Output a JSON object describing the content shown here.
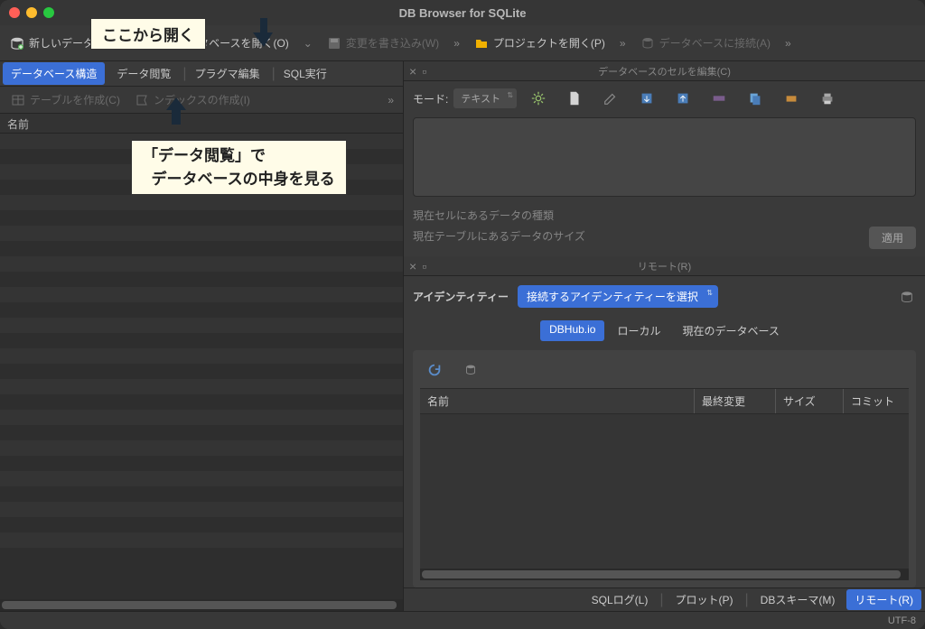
{
  "title": "DB Browser for SQLite",
  "annotation": {
    "callout1": "ここから開く",
    "callout2_line1": "「データ閲覧」で",
    "callout2_line2": "データベースの中身を見る"
  },
  "toolbar": {
    "new_db": "新しいデータベース(N)",
    "open_db": "データベースを開く(O)",
    "write_changes": "変更を書き込み(W)",
    "open_project": "プロジェクトを開く(P)",
    "connect_db": "データベースに接続(A)"
  },
  "tabs": {
    "structure": "データベース構造",
    "browse": "データ閲覧",
    "pragma": "プラグマ編集",
    "sql": "SQL実行"
  },
  "subtools": {
    "create_table": "テーブルを作成(C)",
    "create_index": "ンデックスの作成(I)"
  },
  "list_header": {
    "name": "名前"
  },
  "cell_edit": {
    "title": "データベースのセルを編集(C)",
    "mode_label": "モード:",
    "mode_value": "テキスト",
    "info1": "現在セルにあるデータの種類",
    "info2": "現在テーブルにあるデータのサイズ",
    "apply": "適用"
  },
  "remote": {
    "title": "リモート(R)",
    "identity_label": "アイデンティティー",
    "identity_value": "接続するアイデンティティーを選択",
    "tab_dbhub": "DBHub.io",
    "tab_local": "ローカル",
    "tab_current": "現在のデータベース",
    "col_name": "名前",
    "col_last": "最終変更",
    "col_size": "サイズ",
    "col_commit": "コミット"
  },
  "bottom": {
    "sqllog": "SQLログ(L)",
    "plot": "プロット(P)",
    "schema": "DBスキーマ(M)",
    "remote": "リモート(R)"
  },
  "status": {
    "encoding": "UTF-8"
  }
}
